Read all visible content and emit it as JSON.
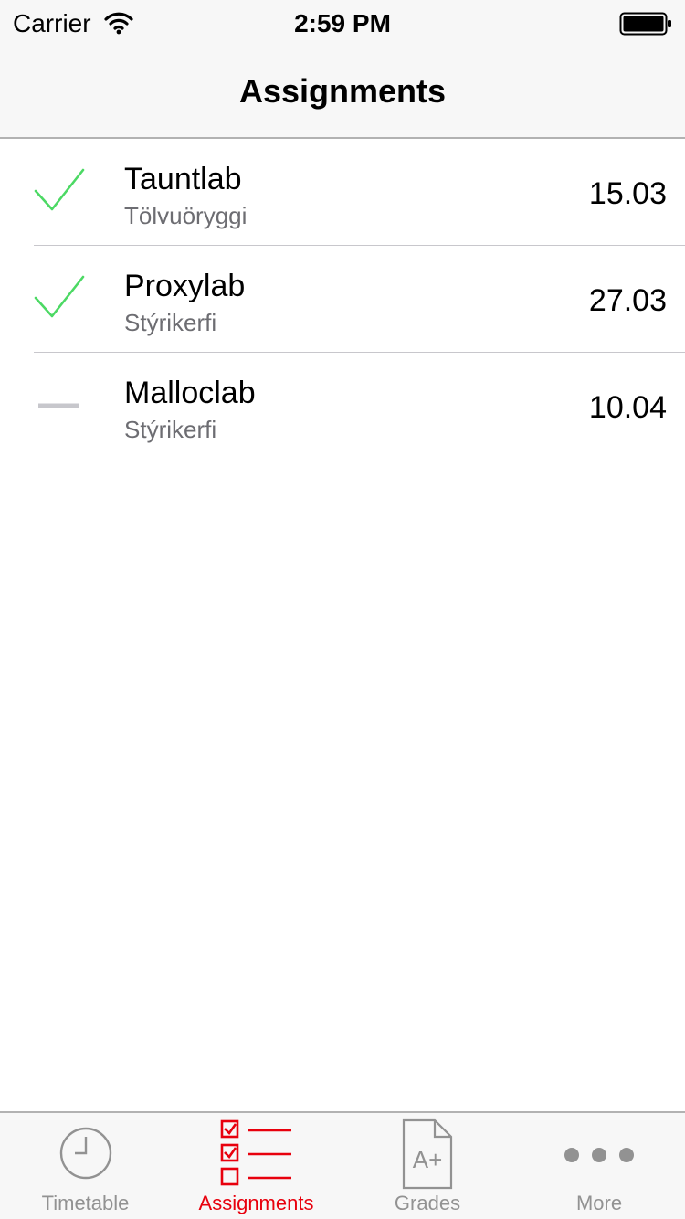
{
  "status_bar": {
    "carrier": "Carrier",
    "time": "2:59 PM",
    "icons": [
      "wifi-icon",
      "battery-icon"
    ]
  },
  "nav": {
    "title": "Assignments"
  },
  "assignments": [
    {
      "title": "Tauntlab",
      "course": "Tölvuöryggi",
      "due": "15.03",
      "status": "done",
      "status_icon": "checkmark-icon"
    },
    {
      "title": "Proxylab",
      "course": "Stýrikerfi",
      "due": "27.03",
      "status": "done",
      "status_icon": "checkmark-icon"
    },
    {
      "title": "Malloclab",
      "course": "Stýrikerfi",
      "due": "10.04",
      "status": "pending",
      "status_icon": "dash-icon"
    }
  ],
  "tabs": [
    {
      "label": "Timetable",
      "icon": "clock-icon",
      "active": false
    },
    {
      "label": "Assignments",
      "icon": "checklist-icon",
      "active": true
    },
    {
      "label": "Grades",
      "icon": "grade-document-icon",
      "active": false
    },
    {
      "label": "More",
      "icon": "more-dots-icon",
      "active": false
    }
  ],
  "colors": {
    "accent": "#e8000d",
    "done": "#4cd964",
    "pending": "#c7c7cc",
    "inactive_tab": "#929292"
  }
}
